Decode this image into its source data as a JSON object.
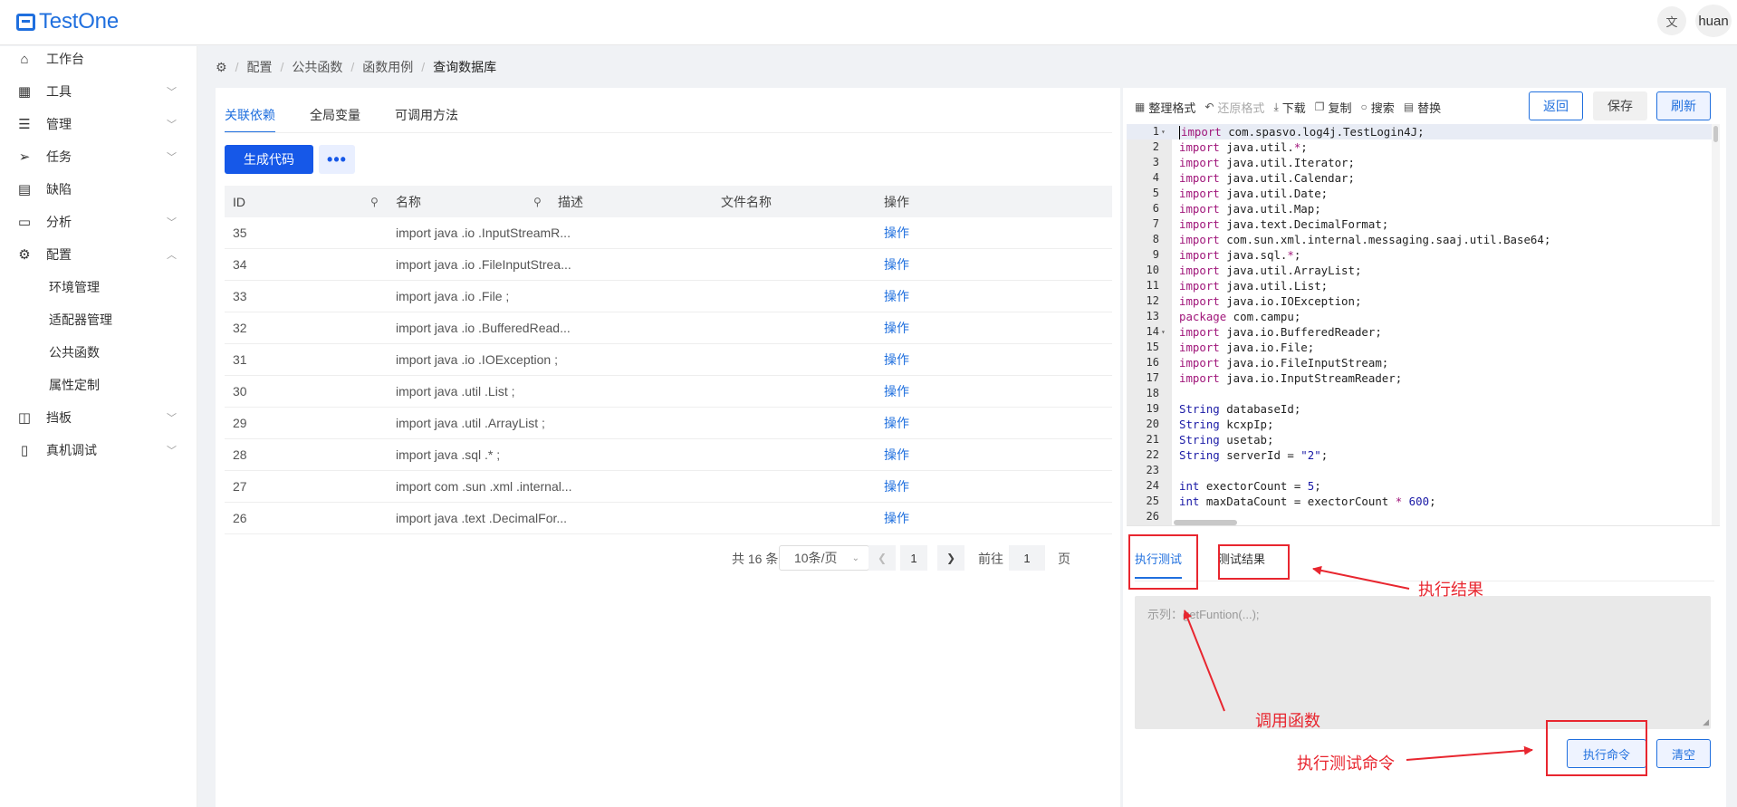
{
  "app": {
    "logo_text": "TestOne",
    "lang_icon": "文",
    "user": "huan"
  },
  "sidebar": {
    "items": [
      {
        "label": "工作台",
        "icon": "home-icon",
        "glyph": "⌂",
        "chevron": ""
      },
      {
        "label": "工具",
        "icon": "grid-icon",
        "glyph": "▦",
        "chevron": "﹀"
      },
      {
        "label": "管理",
        "icon": "list-icon",
        "glyph": "☰",
        "chevron": "﹀"
      },
      {
        "label": "任务",
        "icon": "send-icon",
        "glyph": "➢",
        "chevron": "﹀"
      },
      {
        "label": "缺陷",
        "icon": "document-icon",
        "glyph": "▤",
        "chevron": ""
      },
      {
        "label": "分析",
        "icon": "calendar-icon",
        "glyph": "▭",
        "chevron": "﹀"
      },
      {
        "label": "配置",
        "icon": "gear-icon",
        "glyph": "⚙",
        "chevron": "︿"
      }
    ],
    "sub_items": [
      "环境管理",
      "适配器管理",
      "公共函数",
      "属性定制"
    ],
    "bottom_items": [
      {
        "label": "挡板",
        "icon": "panel-icon",
        "glyph": "◫",
        "chevron": "﹀"
      },
      {
        "label": "真机调试",
        "icon": "device-icon",
        "glyph": "▯",
        "chevron": "﹀"
      }
    ]
  },
  "breadcrumb": {
    "home_icon": "⚙",
    "items": [
      "配置",
      "公共函数",
      "函数用例"
    ],
    "current": "查询数据库"
  },
  "left": {
    "tabs": [
      "关联依赖",
      "全局变量",
      "可调用方法"
    ],
    "generate_label": "生成代码",
    "more_label": "•••",
    "columns": [
      "ID",
      "名称",
      "描述",
      "文件名称",
      "操作"
    ],
    "rows": [
      {
        "id": "35",
        "name": "import java .io .InputStreamR...",
        "desc": "",
        "file": "",
        "op": "操作"
      },
      {
        "id": "34",
        "name": "import java .io .FileInputStrea...",
        "desc": "",
        "file": "",
        "op": "操作"
      },
      {
        "id": "33",
        "name": "import java .io .File ;",
        "desc": "",
        "file": "",
        "op": "操作"
      },
      {
        "id": "32",
        "name": "import java .io .BufferedRead...",
        "desc": "",
        "file": "",
        "op": "操作"
      },
      {
        "id": "31",
        "name": "import java .io .IOException ;",
        "desc": "",
        "file": "",
        "op": "操作"
      },
      {
        "id": "30",
        "name": "import java .util .List ;",
        "desc": "",
        "file": "",
        "op": "操作"
      },
      {
        "id": "29",
        "name": "import java .util .ArrayList ;",
        "desc": "",
        "file": "",
        "op": "操作"
      },
      {
        "id": "28",
        "name": "import java .sql .* ;",
        "desc": "",
        "file": "",
        "op": "操作"
      },
      {
        "id": "27",
        "name": "import com .sun .xml .internal...",
        "desc": "",
        "file": "",
        "op": "操作"
      },
      {
        "id": "26",
        "name": "import java .text .DecimalFor...",
        "desc": "",
        "file": "",
        "op": "操作"
      }
    ],
    "pager": {
      "total": "共 16 条",
      "page_size": "10条/页",
      "current_page": "1",
      "goto_label": "前往",
      "goto_value": "1",
      "page_suffix": "页"
    }
  },
  "right": {
    "toolbar": [
      {
        "label": "整理格式",
        "icon": "format-icon",
        "glyph": "▦",
        "disabled": false
      },
      {
        "label": "还原格式",
        "icon": "undo-icon",
        "glyph": "↶",
        "disabled": true
      },
      {
        "label": "下载",
        "icon": "download-icon",
        "glyph": "⤓",
        "disabled": false
      },
      {
        "label": "复制",
        "icon": "copy-icon",
        "glyph": "❐",
        "disabled": false
      },
      {
        "label": "搜索",
        "icon": "search-icon",
        "glyph": "○",
        "disabled": false
      },
      {
        "label": "替换",
        "icon": "replace-icon",
        "glyph": "▤",
        "disabled": false
      }
    ],
    "back_label": "返回",
    "save_label": "保存",
    "refresh_label": "刷新",
    "code_lines": [
      "import com.spasvo.log4j.TestLogin4J;",
      "import java.util.*;",
      "import java.util.Iterator;",
      "import java.util.Calendar;",
      "import java.util.Date;",
      "import java.util.Map;",
      "import java.text.DecimalFormat;",
      "import com.sun.xml.internal.messaging.saaj.util.Base64;",
      "import java.sql.*;",
      "import java.util.ArrayList;",
      "import java.util.List;",
      "import java.io.IOException;",
      "package com.campu;",
      "import java.io.BufferedReader;",
      "import java.io.File;",
      "import java.io.FileInputStream;",
      "import java.io.InputStreamReader;",
      "",
      "String databaseId;",
      "String kcxpIp;",
      "String usetab;",
      "String serverId = \"2\";",
      "",
      "int exectorCount = 5;",
      "int maxDataCount = exectorCount * 600;",
      ""
    ],
    "fold_lines": [
      1,
      14
    ],
    "result_tabs": [
      "执行测试",
      "测试结果"
    ],
    "command_placeholder": "示列：getFuntion(...);",
    "execute_label": "执行命令",
    "clear_label": "清空"
  },
  "annotations": {
    "result_label": "执行结果",
    "call_label": "调用函数",
    "exec_label": "执行测试命令",
    "color": "#e8262f"
  },
  "colors": {
    "primary": "#1f6fde",
    "primary_button": "#1658e8",
    "keyword": "#a0167a"
  }
}
